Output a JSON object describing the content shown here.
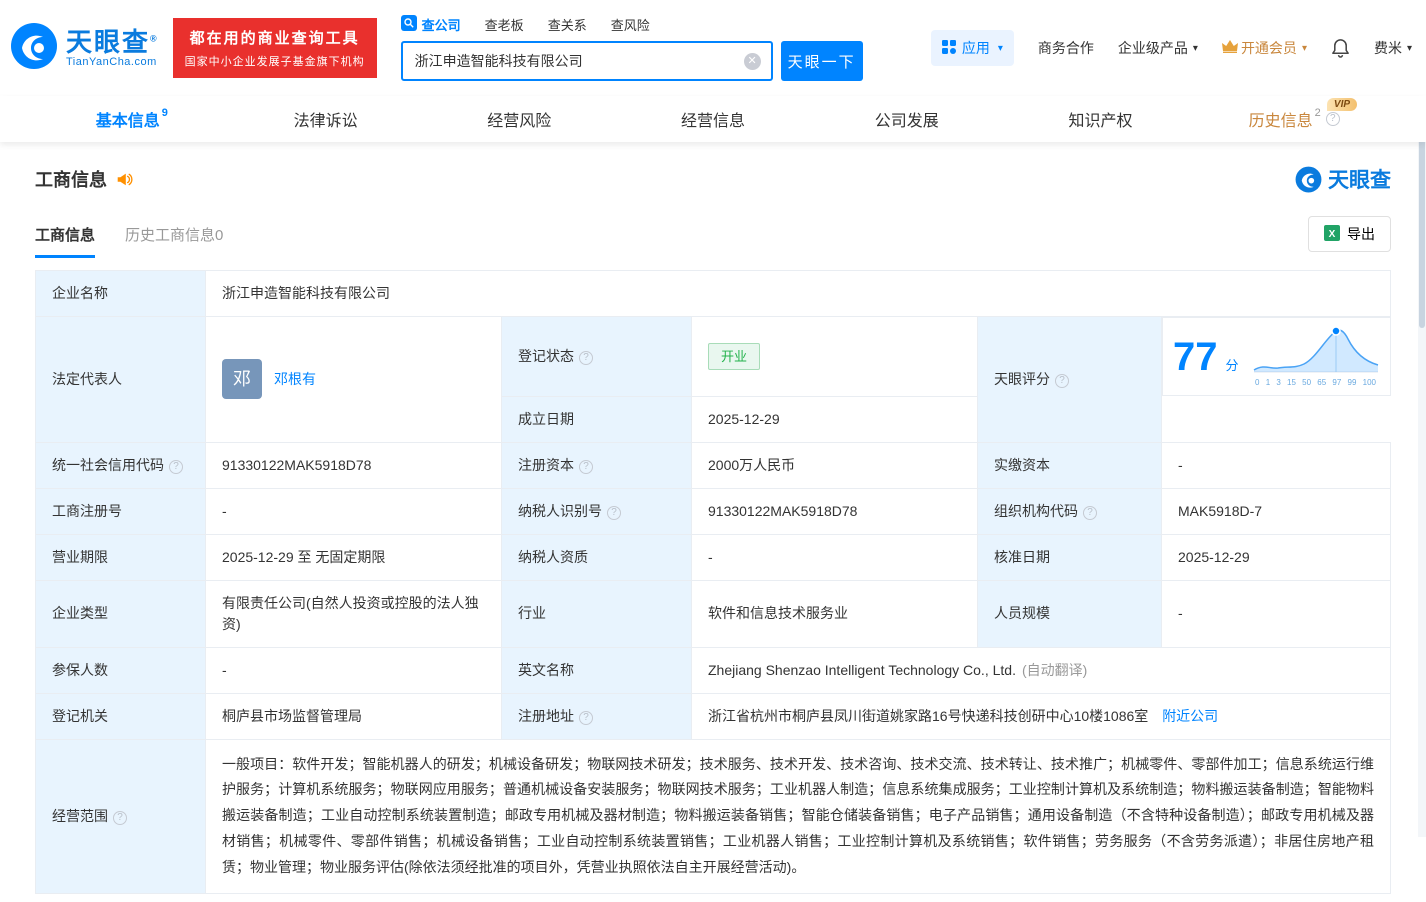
{
  "colors": {
    "primary": "#0084ff",
    "red": "#e9302d",
    "green": "#23b24b",
    "gold": "#c9873d"
  },
  "header": {
    "logo": {
      "name": "天眼查",
      "domain": "TianYanCha.com"
    },
    "slogan_line1": "都在用的商业查询工具",
    "slogan_line2": "国家中小企业发展子基金旗下机构",
    "search": {
      "tabs": [
        {
          "label": "查公司"
        },
        {
          "label": "查老板"
        },
        {
          "label": "查关系"
        },
        {
          "label": "查风险"
        }
      ],
      "value": "浙江申造智能科技有限公司",
      "button": "天眼一下"
    },
    "app_label": "应用",
    "cooperation": "商务合作",
    "enterprise": "企业级产品",
    "member": "开通会员",
    "user": "费米"
  },
  "nav": {
    "tabs": [
      {
        "label": "基本信息",
        "badge": "9"
      },
      {
        "label": "法律诉讼"
      },
      {
        "label": "经营风险"
      },
      {
        "label": "经营信息"
      },
      {
        "label": "公司发展"
      },
      {
        "label": "知识产权"
      },
      {
        "label": "历史信息",
        "badge": "2",
        "vip": "VIP"
      }
    ]
  },
  "section": {
    "title": "工商信息",
    "brand": "天眼查",
    "tabs": [
      {
        "label": "工商信息"
      },
      {
        "label": "历史工商信息0"
      }
    ],
    "export_label": "导出"
  },
  "table": {
    "company_name": {
      "label": "企业名称",
      "value": "浙江申造智能科技有限公司"
    },
    "legal_rep": {
      "label": "法定代表人",
      "avatar": "邓",
      "value": "邓根有"
    },
    "reg_status": {
      "label": "登记状态",
      "value": "开业"
    },
    "establish_date": {
      "label": "成立日期",
      "value": "2025-12-29"
    },
    "score": {
      "label": "天眼评分",
      "value": "77",
      "unit": "分",
      "axis": "0 1 3 15 50 65 97 99 100"
    },
    "credit_code": {
      "label": "统一社会信用代码",
      "value": "91330122MAK5918D78"
    },
    "reg_capital": {
      "label": "注册资本",
      "value": "2000万人民币"
    },
    "paid_capital": {
      "label": "实缴资本",
      "value": "-"
    },
    "reg_number": {
      "label": "工商注册号",
      "value": "-"
    },
    "taxpayer_id": {
      "label": "纳税人识别号",
      "value": "91330122MAK5918D78"
    },
    "org_code": {
      "label": "组织机构代码",
      "value": "MAK5918D-7"
    },
    "business_term": {
      "label": "营业期限",
      "value": "2025-12-29 至 无固定期限"
    },
    "taxpayer_qualification": {
      "label": "纳税人资质",
      "value": "-"
    },
    "approval_date": {
      "label": "核准日期",
      "value": "2025-12-29"
    },
    "company_type": {
      "label": "企业类型",
      "value": "有限责任公司(自然人投资或控股的法人独资)"
    },
    "industry": {
      "label": "行业",
      "value": "软件和信息技术服务业"
    },
    "staff_size": {
      "label": "人员规模",
      "value": "-"
    },
    "insured_count": {
      "label": "参保人数",
      "value": "-"
    },
    "english_name": {
      "label": "英文名称",
      "value": "Zhejiang Shenzao Intelligent Technology Co., Ltd.",
      "note": "(自动翻译)"
    },
    "reg_authority": {
      "label": "登记机关",
      "value": "桐庐县市场监督管理局"
    },
    "reg_address": {
      "label": "注册地址",
      "value": "浙江省杭州市桐庐县凤川街道姚家路16号快递科技创研中心10楼1086室",
      "link": "附近公司"
    },
    "business_scope": {
      "label": "经营范围",
      "value": "一般项目：软件开发；智能机器人的研发；机械设备研发；物联网技术研发；技术服务、技术开发、技术咨询、技术交流、技术转让、技术推广；机械零件、零部件加工；信息系统运行维护服务；计算机系统服务；物联网应用服务；普通机械设备安装服务；物联网技术服务；工业机器人制造；信息系统集成服务；工业控制计算机及系统制造；物料搬运装备制造；智能物料搬运装备制造；工业自动控制系统装置制造；邮政专用机械及器材制造；物料搬运装备销售；智能仓储装备销售；电子产品销售；通用设备制造（不含特种设备制造）；邮政专用机械及器材销售；机械零件、零部件销售；机械设备销售；工业自动控制系统装置销售；工业机器人销售；工业控制计算机及系统销售；软件销售；劳务服务（不含劳务派遣）；非居住房地产租赁；物业管理；物业服务评估(除依法须经批准的项目外，凭营业执照依法自主开展经营活动)。"
    }
  }
}
